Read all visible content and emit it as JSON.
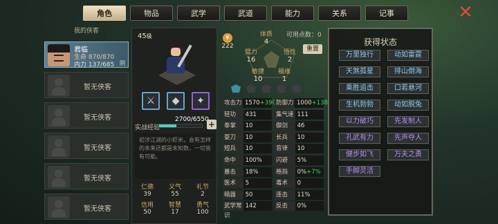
{
  "tabs": [
    "角色",
    "物品",
    "武学",
    "武道",
    "能力",
    "关系",
    "记事"
  ],
  "close_icon": "close-x-icon",
  "left": {
    "title": "我的侠客",
    "hero": {
      "name": "君临",
      "hp": "生命 870/870",
      "mp": "内力 137/685",
      "tag": "阴"
    },
    "empty": "暂无侠客"
  },
  "mid": {
    "level": "45",
    "level_unit": "级",
    "exp_label": "实战经验",
    "exp": "2700/6550",
    "exp_fraction": 0.41,
    "desc": "初涉江湖的小虾米，会有怎样的未来还都是未知数，一切皆有可能。",
    "virtues": [
      {
        "n": "仁德",
        "v": "39"
      },
      {
        "n": "义气",
        "v": "55"
      },
      {
        "n": "礼节",
        "v": "2"
      },
      {
        "n": "信用",
        "v": "50"
      },
      {
        "n": "智慧",
        "v": "17"
      },
      {
        "n": "勇气",
        "v": "100"
      }
    ]
  },
  "attrs": {
    "money": "222",
    "available": "可用点数：0",
    "reset": "重置",
    "physique": {
      "n": "体质",
      "v": "4"
    },
    "strength": {
      "n": "臂力",
      "v": "16"
    },
    "nature": {
      "n": "悟性",
      "v": "2"
    },
    "agility": {
      "n": "敏捷",
      "v": "10"
    },
    "fortune": {
      "n": "福缘",
      "v": "1"
    }
  },
  "stats": [
    [
      "攻击力",
      "1570",
      "+390",
      "防御力",
      "1000",
      "+138"
    ],
    [
      "轻功",
      "431",
      "",
      "集气速度",
      "111",
      ""
    ],
    [
      "拳掌",
      "10",
      "",
      "御剑",
      "46",
      ""
    ],
    [
      "耍刀",
      "10",
      "",
      "长兵",
      "10",
      ""
    ],
    [
      "短兵",
      "10",
      "",
      "音律",
      "10",
      ""
    ],
    [
      "命中",
      "100%",
      "",
      "闪避",
      "5%",
      ""
    ],
    [
      "暴击",
      "18%",
      "",
      "格挡",
      "0%",
      "+7%"
    ],
    [
      "医术",
      "5",
      "",
      "毒术",
      "0",
      ""
    ],
    [
      "暗器",
      "50",
      "",
      "连击",
      "11%",
      ""
    ],
    [
      "武学常识",
      "142",
      "",
      "反击",
      "0%",
      ""
    ]
  ],
  "states": {
    "title": "获得状态",
    "items": [
      "万里独行",
      "动如雷霆",
      "天煞孤星",
      "排山倒海",
      "乘胜追击",
      "口若悬河",
      "生机勃勃",
      "动如脱兔",
      "以力破巧",
      "先发制人",
      "孔武有力",
      "先声夺人",
      "健步如飞",
      "万夫之勇",
      "手脚灵活"
    ]
  }
}
